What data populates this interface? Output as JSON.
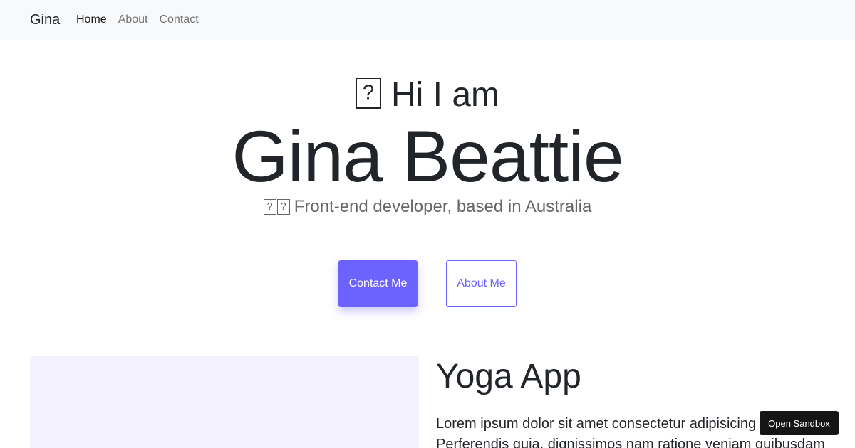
{
  "navbar": {
    "brand": "Gina",
    "links": [
      {
        "label": "Home",
        "active": true
      },
      {
        "label": "About",
        "active": false
      },
      {
        "label": "Contact",
        "active": false
      }
    ]
  },
  "hero": {
    "greeting_emoji": "wave-emoji",
    "greeting": "Hi I am",
    "name": "Gina Beattie",
    "tagline_emoji": "woman-technologist-emoji",
    "tagline": "Front-end developer, based in Australia",
    "primary_button": "Contact Me",
    "secondary_button": "About Me"
  },
  "project": {
    "title": "Yoga App",
    "description_line1": "Lorem ipsum dolor sit amet consectetur adipisicing e",
    "description_line2": "Perferendis quia, dignissimos nam ratione veniam quibusdam"
  },
  "sandbox": {
    "label": "Open Sandbox"
  },
  "colors": {
    "accent": "#6c63ff",
    "navbar_bg": "#f8f9fa",
    "project_image_bg": "#f3f1fe",
    "sandbox_bg": "#151515"
  }
}
